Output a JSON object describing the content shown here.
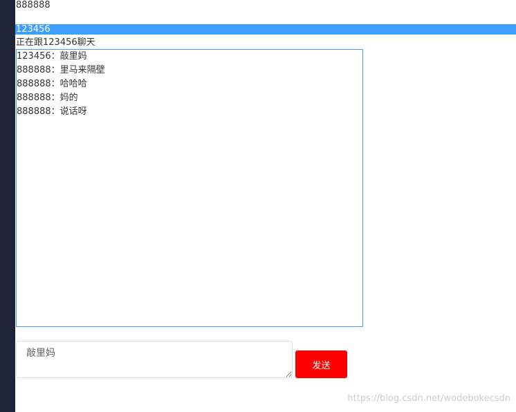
{
  "header": {
    "current_user": "888888"
  },
  "contacts": [
    {
      "name": "123456",
      "selected": true
    }
  ],
  "chat": {
    "chatting_with_prefix": "正在跟",
    "chatting_with_name": "123456",
    "chatting_with_suffix": "聊天",
    "messages": [
      {
        "text": "123456：敲里妈"
      },
      {
        "text": "888888：里马来隔壁"
      },
      {
        "text": "888888：哈哈哈"
      },
      {
        "text": "888888：妈的"
      },
      {
        "text": "888888：说话呀"
      }
    ]
  },
  "composer": {
    "input_value": "敲里妈",
    "send_label": "发送"
  },
  "watermark": "https://blog.csdn.net/wodebokecsdn",
  "colors": {
    "selected_row": "#409eff",
    "message_border": "#409eff",
    "send_button": "#ff0000",
    "left_strip": "#1f2438"
  }
}
